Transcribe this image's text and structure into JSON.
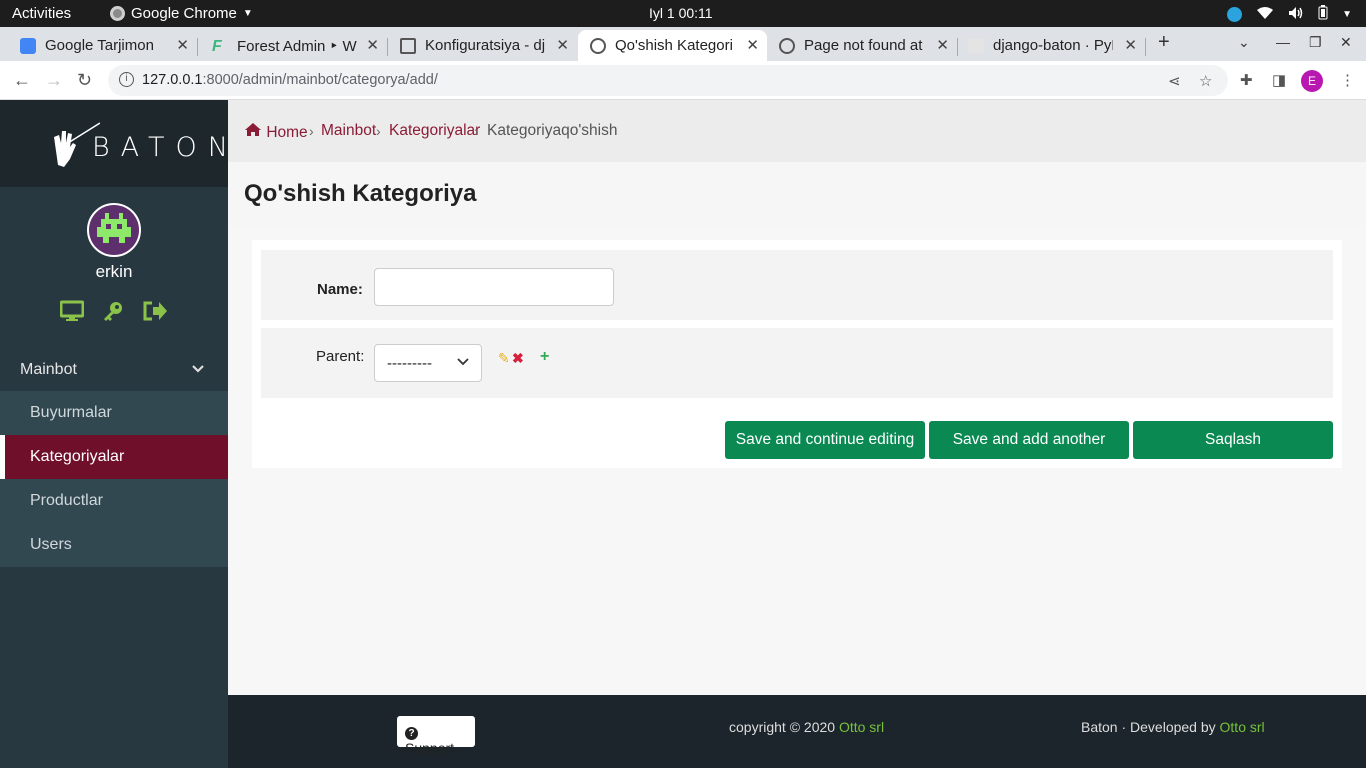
{
  "os": {
    "activities": "Activities",
    "app_name": "Google Chrome",
    "clock": "Iyl 1  00:11"
  },
  "tabs": [
    {
      "title": "Google Tarjimon",
      "favicon": "google-translate-icon",
      "active": false
    },
    {
      "title": "Forest Admin ‣ Wo",
      "favicon": "forest-admin-icon",
      "active": false
    },
    {
      "title": "Konfiguratsiya - dj",
      "favicon": "page-icon",
      "active": false
    },
    {
      "title": "Qo'shish Kategori",
      "favicon": "globe-icon",
      "active": true
    },
    {
      "title": "Page not found at",
      "favicon": "globe-icon",
      "active": false
    },
    {
      "title": "django-baton · PyP",
      "favicon": "pypi-icon",
      "active": false
    }
  ],
  "address": {
    "host": "127.0.0.1",
    "path": ":8000/admin/mainbot/categorya/add/",
    "profile_initial": "E"
  },
  "sidebar": {
    "brand": "BATON",
    "username": "erkin",
    "app_label": "Mainbot",
    "items": [
      {
        "label": "Buyurmalar",
        "active": false
      },
      {
        "label": "Kategoriyalar",
        "active": true
      },
      {
        "label": "Productlar",
        "active": false
      },
      {
        "label": "Users",
        "active": false
      }
    ]
  },
  "breadcrumb": {
    "home": "Home",
    "app": "Mainbot",
    "model": "Kategoriyalar",
    "current": "Kategoriyaqo'shish"
  },
  "page": {
    "title": "Qo'shish Kategoriya"
  },
  "form": {
    "name_label": "Name:",
    "name_value": "",
    "parent_label": "Parent:",
    "parent_value": "---------",
    "buttons": {
      "continue": "Save and continue editing",
      "add_another": "Save and add another",
      "save": "Saqlash"
    }
  },
  "footer": {
    "support": "Support",
    "copyright_prefix": "copyright © 2020 ",
    "copyright_link": "Otto srl",
    "dev_prefix": "Baton · Developed by ",
    "dev_link": "Otto srl"
  },
  "colors": {
    "accent": "#8b1c35",
    "sidebar_bg": "#283840",
    "active_item": "#6f0f2a",
    "button_green": "#0a8a52",
    "link_green": "#77c23a"
  }
}
